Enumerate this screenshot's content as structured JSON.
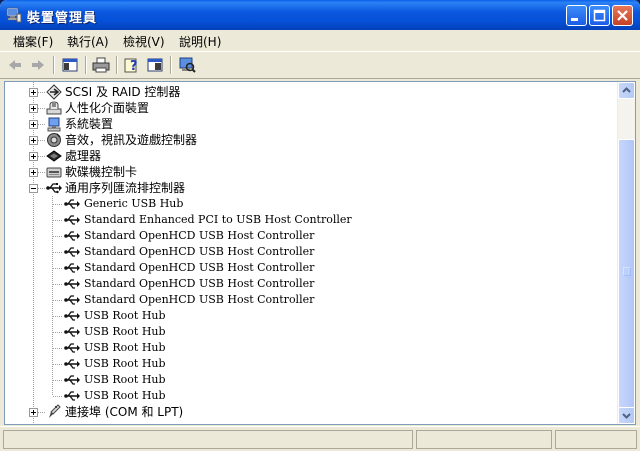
{
  "window": {
    "title": "裝置管理員",
    "controls": [
      "minimize-icon",
      "maximize-icon",
      "close-icon"
    ]
  },
  "menubar": {
    "items": [
      {
        "label": "檔案(F)"
      },
      {
        "label": "執行(A)"
      },
      {
        "label": "檢視(V)"
      },
      {
        "label": "說明(H)"
      }
    ]
  },
  "toolbar": {
    "buttons": [
      "back-arrow-icon",
      "forward-arrow-icon",
      "show-hide-console-tree-icon",
      "print-icon",
      "properties-help-icon",
      "properties-icon",
      "scan-hardware-icon"
    ]
  },
  "tree": {
    "categories_top": [
      {
        "label": "SCSI 及 RAID 控制器",
        "icon": "scsi-icon",
        "expanded": false
      },
      {
        "label": "人性化介面裝置",
        "icon": "hid-icon",
        "expanded": false
      },
      {
        "label": "系統裝置",
        "icon": "system-device-icon",
        "expanded": false
      },
      {
        "label": "音效，視訊及遊戲控制器",
        "icon": "audio-icon",
        "expanded": false
      },
      {
        "label": "處理器",
        "icon": "processor-icon",
        "expanded": false
      },
      {
        "label": "軟碟機控制卡",
        "icon": "floppy-controller-icon",
        "expanded": false
      }
    ],
    "usb_category": {
      "label": "通用序列匯流排控制器",
      "icon": "usb-icon",
      "expanded": true
    },
    "usb_devices": [
      "Generic USB Hub",
      "Standard Enhanced PCI to USB Host Controller",
      "Standard OpenHCD USB Host Controller",
      "Standard OpenHCD USB Host Controller",
      "Standard OpenHCD USB Host Controller",
      "Standard OpenHCD USB Host Controller",
      "Standard OpenHCD USB Host Controller",
      "USB Root Hub",
      "USB Root Hub",
      "USB Root Hub",
      "USB Root Hub",
      "USB Root Hub",
      "USB Root Hub"
    ],
    "categories_bottom": [
      {
        "label": "連接埠 (COM 和 LPT)",
        "icon": "port-icon",
        "expanded": false
      }
    ]
  },
  "colors": {
    "titlebar": "#0551D8",
    "window_bg": "#ECE9D8",
    "tree_bg": "#FFFFFF"
  }
}
